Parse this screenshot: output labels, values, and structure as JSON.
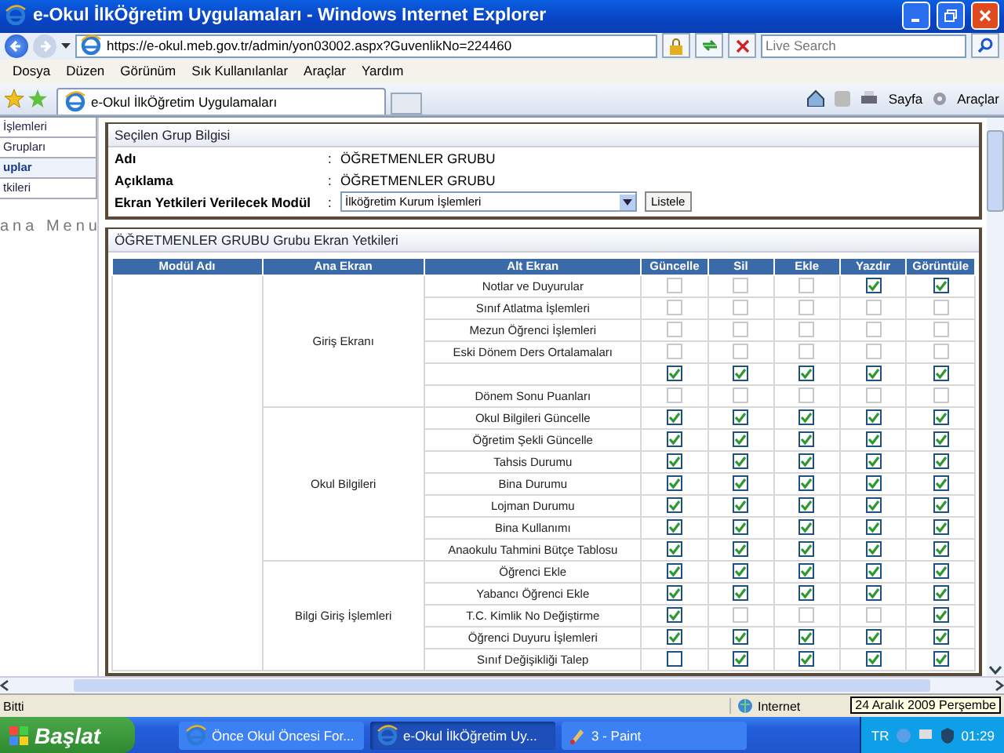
{
  "window": {
    "title": "e-Okul İlkÖğretim Uygulamaları - Windows Internet Explorer"
  },
  "address_bar": {
    "url": "https://e-okul.meb.gov.tr/admin/yon03002.aspx?GuvenlikNo=224460",
    "search_placeholder": "Live Search"
  },
  "menu": [
    "Dosya",
    "Düzen",
    "Görünüm",
    "Sık Kullanılanlar",
    "Araçlar",
    "Yardım"
  ],
  "tabs": [
    {
      "label": "e-Okul İlkÖğretim Uygulamaları",
      "selected": true
    }
  ],
  "command_bar": [
    "Sayfa",
    "Araçlar"
  ],
  "sidebar": {
    "items": [
      {
        "label": "İşlemleri",
        "selected": false
      },
      {
        "label": "Grupları",
        "selected": false
      },
      {
        "label": "uplar",
        "selected": true
      },
      {
        "label": "tkileri",
        "selected": false
      }
    ],
    "caption": "ana Menu"
  },
  "group_info": {
    "title": "Seçilen Grup Bilgisi",
    "fields": [
      {
        "label": "Adı",
        "value": "ÖĞRETMENLER GRUBU",
        "kind": "text"
      },
      {
        "label": "Açıklama",
        "value": "ÖĞRETMENLER GRUBU",
        "kind": "text"
      },
      {
        "label": "Ekran Yetkileri Verilecek Modül",
        "value": "İlköğretim Kurum İşlemleri",
        "kind": "select"
      }
    ],
    "separator": ":",
    "button": "Listele"
  },
  "permissions": {
    "title": "ÖĞRETMENLER GRUBU  Grubu Ekran Yetkileri",
    "columns": [
      "Modül Adı",
      "Ana Ekran",
      "Alt Ekran",
      "Güncelle",
      "Sil",
      "Ekle",
      "Yazdır",
      "Görüntüle"
    ],
    "groups": [
      {
        "name": "Giriş Ekranı",
        "rows": [
          {
            "screen": "Notlar ve Duyurular",
            "perms": [
              {
                "checked": false,
                "disabled": true
              },
              {
                "checked": false,
                "disabled": true
              },
              {
                "checked": false,
                "disabled": true
              },
              {
                "checked": true,
                "disabled": false
              },
              {
                "checked": true,
                "disabled": false
              }
            ]
          },
          {
            "screen": "Sınıf Atlatma İşlemleri",
            "perms": [
              {
                "checked": false,
                "disabled": true
              },
              {
                "checked": false,
                "disabled": true
              },
              {
                "checked": false,
                "disabled": true
              },
              {
                "checked": false,
                "disabled": true
              },
              {
                "checked": false,
                "disabled": true
              }
            ]
          },
          {
            "screen": "Mezun Öğrenci İşlemleri",
            "perms": [
              {
                "checked": false,
                "disabled": true
              },
              {
                "checked": false,
                "disabled": true
              },
              {
                "checked": false,
                "disabled": true
              },
              {
                "checked": false,
                "disabled": true
              },
              {
                "checked": false,
                "disabled": true
              }
            ]
          },
          {
            "screen": "Eski Dönem Ders Ortalamaları",
            "perms": [
              {
                "checked": false,
                "disabled": true
              },
              {
                "checked": false,
                "disabled": true
              },
              {
                "checked": false,
                "disabled": true
              },
              {
                "checked": false,
                "disabled": true
              },
              {
                "checked": false,
                "disabled": true
              }
            ]
          },
          {
            "perms": [
              {
                "checked": true,
                "disabled": false
              },
              {
                "checked": true,
                "disabled": false
              },
              {
                "checked": true,
                "disabled": false
              },
              {
                "checked": true,
                "disabled": false
              },
              {
                "checked": true,
                "disabled": false
              }
            ]
          },
          {
            "screen": "Dönem Sonu Puanları",
            "perms": [
              {
                "checked": false,
                "disabled": true
              },
              {
                "checked": false,
                "disabled": true
              },
              {
                "checked": false,
                "disabled": true
              },
              {
                "checked": false,
                "disabled": true
              },
              {
                "checked": false,
                "disabled": true
              }
            ]
          }
        ]
      },
      {
        "name": "Okul Bilgileri",
        "rows": [
          {
            "screen": "Okul Bilgileri Güncelle",
            "perms": [
              {
                "checked": true,
                "disabled": false
              },
              {
                "checked": true,
                "disabled": false
              },
              {
                "checked": true,
                "disabled": false
              },
              {
                "checked": true,
                "disabled": false
              },
              {
                "checked": true,
                "disabled": false
              }
            ]
          },
          {
            "screen": "Öğretim Şekli Güncelle",
            "perms": [
              {
                "checked": true,
                "disabled": false
              },
              {
                "checked": true,
                "disabled": false
              },
              {
                "checked": true,
                "disabled": false
              },
              {
                "checked": true,
                "disabled": false
              },
              {
                "checked": true,
                "disabled": false
              }
            ]
          },
          {
            "screen": "Tahsis Durumu",
            "perms": [
              {
                "checked": true,
                "disabled": false
              },
              {
                "checked": true,
                "disabled": false
              },
              {
                "checked": true,
                "disabled": false
              },
              {
                "checked": true,
                "disabled": false
              },
              {
                "checked": true,
                "disabled": false
              }
            ]
          },
          {
            "screen": "Bina Durumu",
            "perms": [
              {
                "checked": true,
                "disabled": false
              },
              {
                "checked": true,
                "disabled": false
              },
              {
                "checked": true,
                "disabled": false
              },
              {
                "checked": true,
                "disabled": false
              },
              {
                "checked": true,
                "disabled": false
              }
            ]
          },
          {
            "screen": "Lojman Durumu",
            "perms": [
              {
                "checked": true,
                "disabled": false
              },
              {
                "checked": true,
                "disabled": false
              },
              {
                "checked": true,
                "disabled": false
              },
              {
                "checked": true,
                "disabled": false
              },
              {
                "checked": true,
                "disabled": false
              }
            ]
          },
          {
            "screen": "Bina Kullanımı",
            "perms": [
              {
                "checked": true,
                "disabled": false
              },
              {
                "checked": true,
                "disabled": false
              },
              {
                "checked": true,
                "disabled": false
              },
              {
                "checked": true,
                "disabled": false
              },
              {
                "checked": true,
                "disabled": false
              }
            ]
          },
          {
            "screen": "Anaokulu Tahmini Bütçe Tablosu",
            "perms": [
              {
                "checked": true,
                "disabled": false
              },
              {
                "checked": true,
                "disabled": false
              },
              {
                "checked": true,
                "disabled": false
              },
              {
                "checked": true,
                "disabled": false
              },
              {
                "checked": true,
                "disabled": false
              }
            ]
          }
        ]
      },
      {
        "name": "Bilgi Giriş İşlemleri",
        "rows": [
          {
            "screen": "Öğrenci Ekle",
            "perms": [
              {
                "checked": true,
                "disabled": false
              },
              {
                "checked": true,
                "disabled": false
              },
              {
                "checked": true,
                "disabled": false
              },
              {
                "checked": true,
                "disabled": false
              },
              {
                "checked": true,
                "disabled": false
              }
            ]
          },
          {
            "screen": "Yabancı Öğrenci Ekle",
            "perms": [
              {
                "checked": true,
                "disabled": false
              },
              {
                "checked": true,
                "disabled": false
              },
              {
                "checked": true,
                "disabled": false
              },
              {
                "checked": true,
                "disabled": false
              },
              {
                "checked": true,
                "disabled": false
              }
            ]
          },
          {
            "screen": "T.C. Kimlik No Değiştirme",
            "perms": [
              {
                "checked": true,
                "disabled": false
              },
              {
                "checked": false,
                "disabled": true
              },
              {
                "checked": false,
                "disabled": true
              },
              {
                "checked": false,
                "disabled": true
              },
              {
                "checked": true,
                "disabled": false
              }
            ]
          },
          {
            "screen": "Öğrenci Duyuru İşlemleri",
            "perms": [
              {
                "checked": true,
                "disabled": false
              },
              {
                "checked": true,
                "disabled": false
              },
              {
                "checked": true,
                "disabled": false
              },
              {
                "checked": true,
                "disabled": false
              },
              {
                "checked": true,
                "disabled": false
              }
            ]
          },
          {
            "screen": "Sınıf Değişikliği Talep",
            "perms": [
              {
                "checked": false,
                "disabled": false
              },
              {
                "checked": true,
                "disabled": false
              },
              {
                "checked": true,
                "disabled": false
              },
              {
                "checked": true,
                "disabled": false
              },
              {
                "checked": true,
                "disabled": false
              }
            ]
          }
        ]
      }
    ]
  },
  "status_bar": {
    "text": "Bitti",
    "zone": "Internet"
  },
  "taskbar": {
    "start": "Başlat",
    "tasks": [
      {
        "label": "Önce Okul Öncesi For...",
        "kind": "browser",
        "selected": false
      },
      {
        "label": "e-Okul İlkÖğretim Uy...",
        "kind": "browser",
        "selected": true
      },
      {
        "label": "3 - Paint",
        "kind": "paint",
        "selected": false
      }
    ],
    "language": "TR",
    "clock": "01:29",
    "tooltip": "24 Aralık 2009 Perşembe"
  }
}
